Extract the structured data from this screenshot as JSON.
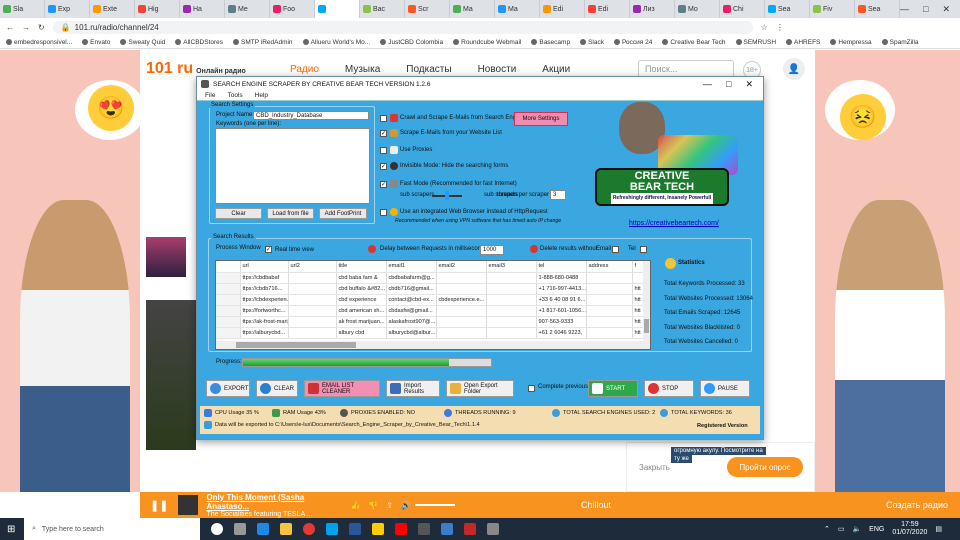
{
  "browser": {
    "tabs": [
      "Sla",
      "Exp",
      "Exte",
      "Hig",
      "Ha",
      "Me",
      "Foo",
      "",
      "Bac",
      "Scr",
      "Ma",
      "Ma",
      "Edi",
      "Edi",
      "Лиз",
      "Mo",
      "Chi",
      "Sea",
      "Fiv",
      "Sea"
    ],
    "url": "101.ru/radio/channel/24",
    "bookmarks": [
      "embedresponsivel...",
      "Envato",
      "Sweaty Quid",
      "AllCBDStores",
      "SMTP iRedAdmin",
      "Allueru World's Mo...",
      "JustCBD Colombia",
      "Roundcube Webmail",
      "Basecamp",
      "Slack",
      "Россия 24",
      "Creative Bear Tech",
      "SEMRUSH",
      "AHREFS",
      "Hempressa",
      "SpamZilla"
    ]
  },
  "site": {
    "logo": "101 ru",
    "logo_sub": "Онлайн радио",
    "nav": [
      "Радио",
      "Музыка",
      "Подкасты",
      "Новости",
      "Акции"
    ],
    "search_placeholder": "Поиск...",
    "age": "18+",
    "promo_close": "Закрыть",
    "promo_button": "Пройти опрос",
    "promo_text1": "огромную акулу. Посмотрите на",
    "promo_text2": "ту же"
  },
  "player": {
    "track": "Only This Moment (Sasha Anastaso...",
    "artist": "The Socialities featuring TESLA ...",
    "station": "Chillout",
    "create": "Создать радио"
  },
  "app": {
    "title": "SEARCH ENGINE SCRAPER BY CREATIVE BEAR TECH VERSION 1.2.6",
    "menu": [
      "File",
      "Tools",
      "Help"
    ],
    "search_settings": "Search Settings",
    "project_name_label": "Project Name:",
    "project_name_value": "CBD_Industry_Database",
    "keywords_label": "Keywords (one per line):",
    "btn_clear": "Clear",
    "btn_load": "Load from file",
    "btn_footprint": "Add FootPrint",
    "opt_crawl": "Crawl and Scrape E-Mails from Search Engines",
    "opt_scrape_list": "Scrape E-Mails from your Website List",
    "opt_proxies": "Use Proxies",
    "opt_invisible": "Invisible Mode: Hide the searching forms",
    "opt_fast": "Fast Mode (Recommended for fast Internet)",
    "sub_scrapers": "sub scrapers",
    "threads_label": "threads per scraper",
    "threads_value": "3",
    "opt_browser": "Use an integrated Web Browser instead of HttpRequest",
    "browser_note": "Recommended when using VPN software that has timed auto IP change",
    "more_settings": "More Settings",
    "logo_line1": "CREATIVE",
    "logo_line2": "BEAR TECH",
    "logo_tag": "Refreshingly different, Insanely Powerfull",
    "site_link": "https://creativebeartech.com/",
    "search_results": "Search Results",
    "process_window": "Process Window",
    "realtime": "Real time view",
    "delay_label": "Delay between Requests in milliseconds:",
    "delay_value": "1000",
    "delete_results": "Delete results without",
    "email": "Email",
    "tel": "Tel",
    "columns": [
      "url",
      "url2",
      "title",
      "email1",
      "email2",
      "email3",
      "tel",
      "address",
      "f"
    ],
    "rows": [
      [
        "ttps://cbdbabaf",
        "",
        "cbd baba fam &",
        "cbdbabafarm@g...",
        "",
        "",
        "1-888-680-0488",
        "",
        ""
      ],
      [
        "ttps://cbdb716...",
        "",
        "cbd buffalo &#82...",
        "cbdb716@gmail...",
        "",
        "",
        "+1 716-997-4413...",
        "",
        "htt"
      ],
      [
        "ttps://cbdexperien...",
        "",
        "cbd experience",
        "contact@cbd-ex...",
        "cbdexperience.e...",
        "",
        "+33 6 40 08 91 6...",
        "",
        "htt"
      ],
      [
        "ttps://fortworthc...",
        "",
        "cbd american sh...",
        "cbdasfw@gmail...",
        "",
        "",
        "+1 817-601-1056...",
        "",
        "htt"
      ],
      [
        "ttps://ak-frost-marijuan...",
        "",
        "ak frost marijuan...",
        "alaskafrost907@...",
        "",
        "",
        "907-563-9333",
        "",
        "htt"
      ],
      [
        "ttps://alburycbd...",
        "",
        "albury cbd",
        "alburycbd@albur...",
        "",
        "",
        "+61 2 6046 9223,",
        "",
        "htt"
      ]
    ],
    "progress_label": "Progress:",
    "progress": 0.83,
    "statistics": "Statistics",
    "stats": [
      "Total Keywords Processed: 33",
      "Total Websites Processed: 13064",
      "Total Emails Scraped: 12645",
      "Total Websites Blacklisted: 0",
      "Total Websites Cancelled: 0"
    ],
    "btn_export": "EXPORT",
    "btn_clear_results": "CLEAR",
    "btn_cleaner": "EMAIL LIST CLEANER",
    "btn_import": "Import Results",
    "btn_open_export": "Open Export Folder",
    "btn_complete": "Complete previous search",
    "btn_start": "START",
    "btn_stop": "STOP",
    "btn_pause": "PAUSE",
    "cpu": "CPU Usage 35 %",
    "ram": "RAM Usage 43%",
    "proxies": "PROXIES ENABLED: NO",
    "threads": "THREADS RUNNING: 9",
    "engines": "TOTAL SEARCH ENGINES USED: 2",
    "keywords_total": "TOTAL KEYWORDS: 36",
    "export_path": "Data will be exported to C:\\Users\\e-lux\\Documents\\Search_Engine_Scraper_by_Creative_Bear_Tech\\1.1.4",
    "registered": "Registered Version"
  },
  "taskbar": {
    "search": "Type here to search",
    "lang": "ENG",
    "time": "17:59",
    "date": "01/07/2020"
  },
  "colors": {
    "accent": "#f7931e",
    "app_bg": "#3ba7e0",
    "progress": "#22b33a",
    "start": "#2ea84a"
  }
}
